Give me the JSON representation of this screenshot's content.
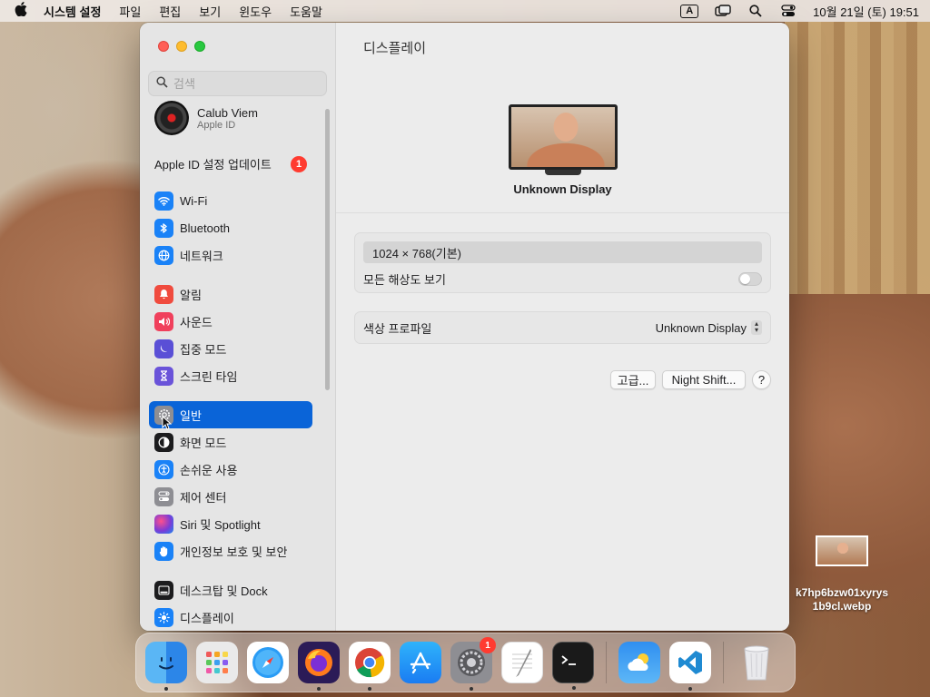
{
  "menubar": {
    "app_name": "시스템 설정",
    "items": [
      "파일",
      "편집",
      "보기",
      "윈도우",
      "도움말"
    ],
    "input_source": "A",
    "clock": "10월 21일 (토) 19:51"
  },
  "sidebar": {
    "search_placeholder": "검색",
    "account": {
      "name": "Calub Viem",
      "subtitle": "Apple ID"
    },
    "update": {
      "label": "Apple ID 설정 업데이트",
      "badge": "1"
    },
    "items": [
      {
        "label": "Wi-Fi",
        "icon": "wifi-icon",
        "color": "#1a82f7"
      },
      {
        "label": "Bluetooth",
        "icon": "bluetooth-icon",
        "color": "#1a82f7"
      },
      {
        "label": "네트워크",
        "icon": "globe-icon",
        "color": "#1a82f7"
      },
      {
        "label": "알림",
        "icon": "bell-icon",
        "color": "#f04b3e"
      },
      {
        "label": "사운드",
        "icon": "speaker-icon",
        "color": "#f0405c"
      },
      {
        "label": "집중 모드",
        "icon": "moon-icon",
        "color": "#5a4fd6"
      },
      {
        "label": "스크린 타임",
        "icon": "hourglass-icon",
        "color": "#6a53d9"
      },
      {
        "label": "일반",
        "icon": "gear-icon",
        "color": "#8e8e93"
      },
      {
        "label": "화면 모드",
        "icon": "appearance-icon",
        "color": "#1c1c1e"
      },
      {
        "label": "손쉬운 사용",
        "icon": "accessibility-icon",
        "color": "#1a82f7"
      },
      {
        "label": "제어 센터",
        "icon": "control-center-icon",
        "color": "#8e8e93"
      },
      {
        "label": "Siri 및 Spotlight",
        "icon": "siri-icon",
        "color": "#b03dd1"
      },
      {
        "label": "개인정보 보호 및 보안",
        "icon": "hand-icon",
        "color": "#1a82f7"
      },
      {
        "label": "데스크탑 및 Dock",
        "icon": "dock-icon",
        "color": "#1c1c1e"
      },
      {
        "label": "디스플레이",
        "icon": "sun-icon",
        "color": "#1a82f7"
      }
    ]
  },
  "main": {
    "title": "디스플레이",
    "display_name": "Unknown Display",
    "resolution": "1024 × 768(기본)",
    "show_all_label": "모든 해상도 보기",
    "color_profile_label": "색상 프로파일",
    "color_profile_value": "Unknown Display",
    "advanced_button": "고급...",
    "night_shift_button": "Night Shift...",
    "help_button": "?"
  },
  "desktop_file": {
    "name_line1": "k7hp6bzw01xyrys",
    "name_line2": "1b9cl.webp"
  },
  "dock": {
    "apps": [
      {
        "name": "Finder",
        "icon": "finder-icon",
        "running": true
      },
      {
        "name": "Launchpad",
        "icon": "launchpad-icon",
        "running": false
      },
      {
        "name": "Safari",
        "icon": "safari-icon",
        "running": false
      },
      {
        "name": "Firefox",
        "icon": "firefox-icon",
        "running": true
      },
      {
        "name": "Chrome",
        "icon": "chrome-icon",
        "running": true
      },
      {
        "name": "App Store",
        "icon": "app-store-icon",
        "running": false
      },
      {
        "name": "System Settings",
        "icon": "system-settings-icon",
        "running": true,
        "badge": "1"
      },
      {
        "name": "TextEdit",
        "icon": "textedit-icon",
        "running": false
      },
      {
        "name": "Terminal",
        "icon": "terminal-icon",
        "running": true
      },
      {
        "name": "Weather",
        "icon": "weather-icon",
        "running": false
      },
      {
        "name": "VS Code",
        "icon": "vscode-icon",
        "running": true
      },
      {
        "name": "Trash",
        "icon": "trash-icon",
        "running": false
      }
    ]
  }
}
